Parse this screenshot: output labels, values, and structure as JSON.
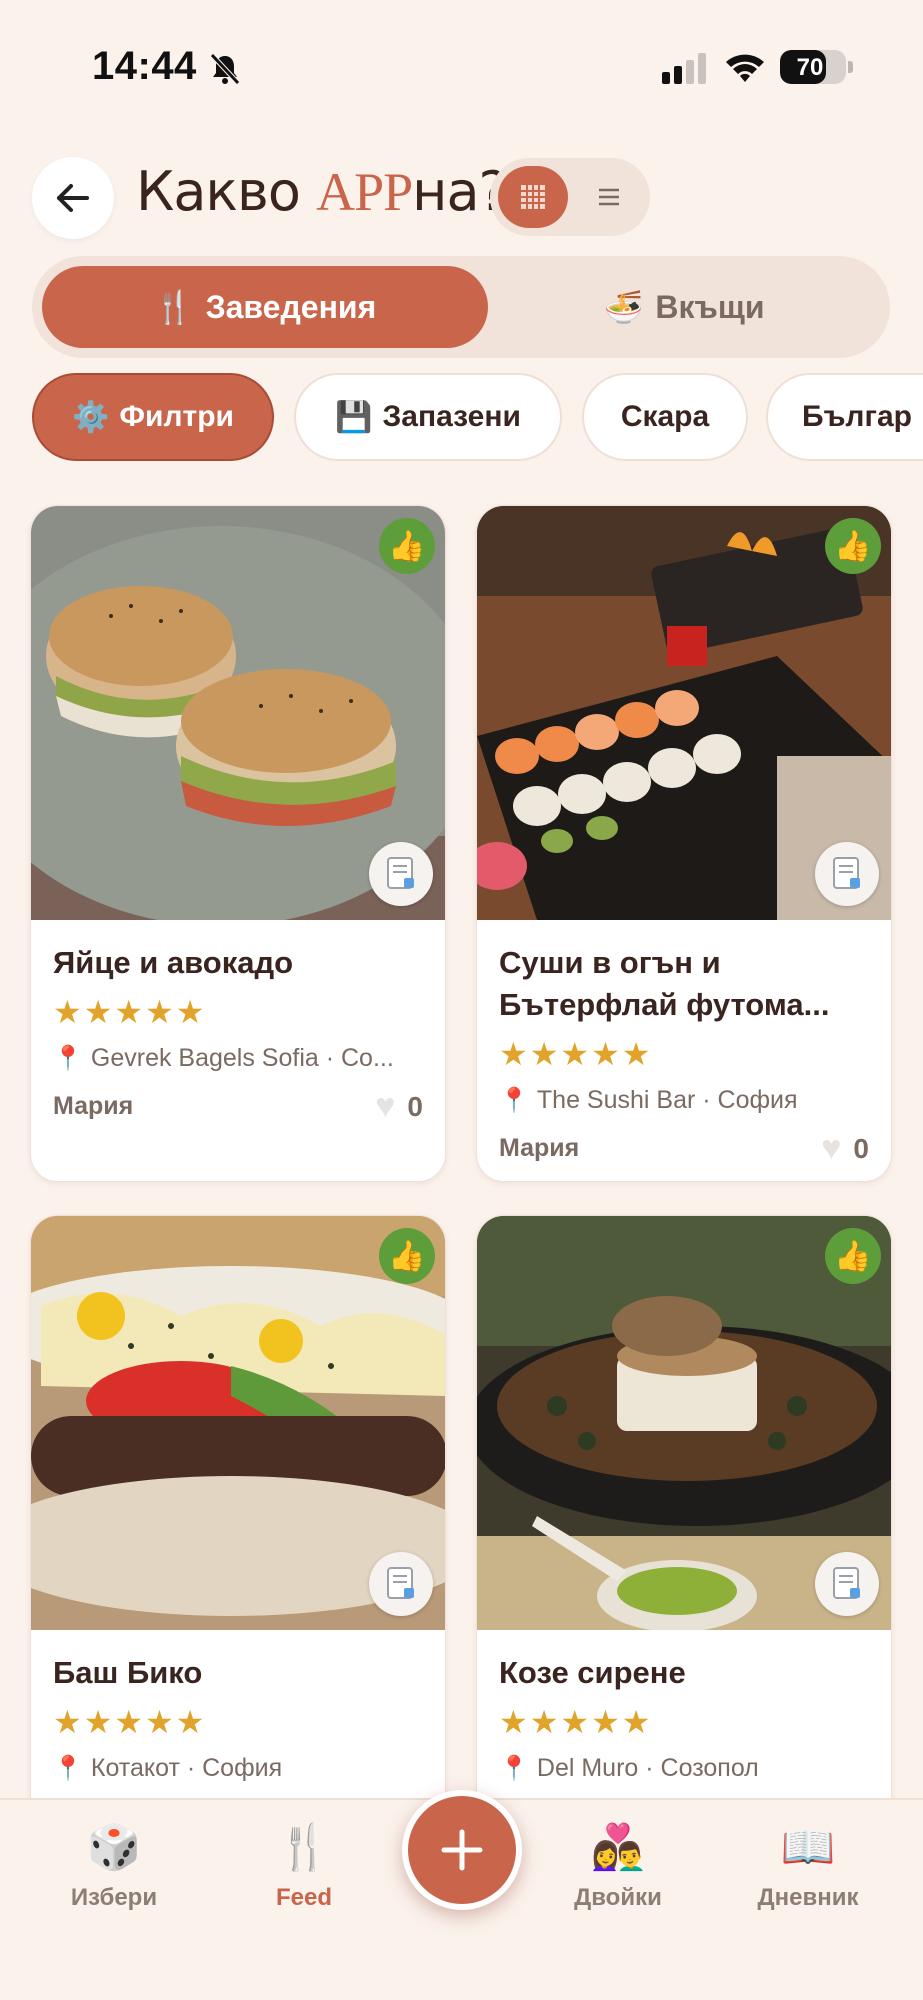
{
  "status_bar": {
    "time": "14:44",
    "battery_level": 70,
    "battery_text": "70"
  },
  "header": {
    "title_prefix": "Какво ",
    "title_accent": "APP",
    "title_suffix": "на?",
    "back_icon": "arrow-left-icon",
    "view_modes": [
      "grid",
      "list"
    ],
    "active_view": "grid"
  },
  "segments": [
    {
      "label": "Заведения",
      "icon": "🍴",
      "active": true
    },
    {
      "label": "Вкъщи",
      "icon": "🍜",
      "active": false
    }
  ],
  "chips": [
    {
      "label": "Филтри",
      "icon": "⚙️",
      "active": true
    },
    {
      "label": "Запазени",
      "icon": "💾",
      "active": false
    },
    {
      "label": "Скара",
      "icon": "",
      "active": false
    },
    {
      "label": "Българ",
      "icon": "",
      "active": false
    }
  ],
  "cards": [
    {
      "title": "Яйце и авокадо",
      "rating": 5,
      "place": "Gevrek Bagels Sofia · Со...",
      "author": "Мария",
      "likes": "0",
      "liked_badge": "👍"
    },
    {
      "title": "Суши в огън и Бътерфлай футома...",
      "rating": 5,
      "place": "The Sushi Bar · София",
      "author": "Мария",
      "likes": "0",
      "liked_badge": "👍"
    },
    {
      "title": "Баш Бико",
      "rating": 5,
      "place": "Котакот · София",
      "author": "",
      "likes": "",
      "liked_badge": "👍"
    },
    {
      "title": "Козе сирене",
      "rating": 5,
      "place": "Del Muro · Созопол",
      "author": "",
      "likes": "",
      "liked_badge": "👍"
    }
  ],
  "stars_text": "★★★★★",
  "nav": [
    {
      "label": "Избери",
      "icon": "🎲",
      "active": false
    },
    {
      "label": "Feed",
      "icon": "🍴",
      "active": true
    },
    {
      "label": "Двойки",
      "icon": "👩‍❤️‍👨",
      "active": false
    },
    {
      "label": "Дневник",
      "icon": "📖",
      "active": false
    }
  ],
  "fab_icon": "plus-icon",
  "colors": {
    "accent": "#C9654B",
    "background": "#FBF2EC",
    "star": "#E2A32B",
    "like_badge": "#5E9E3A"
  }
}
